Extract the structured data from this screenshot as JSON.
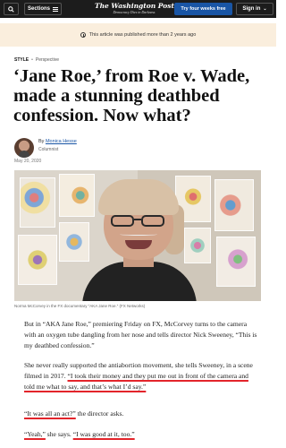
{
  "nav": {
    "sections_label": "Sections",
    "masthead": "The Washington Post",
    "tagline": "Democracy Dies in Darkness",
    "subscribe_label": "Try four weeks free",
    "signin_label": "Sign in",
    "signin_chevron": "⌄"
  },
  "banner": {
    "text": "This article was published more than 2 years ago"
  },
  "kicker": {
    "section": "STYLE",
    "separator": "•",
    "label": "Perspective"
  },
  "headline": "‘Jane Roe,’ from Roe v. Wade, made a stunning deathbed confession. Now what?",
  "byline": {
    "by": "By",
    "author": "Monica Hesse",
    "role": "Columnist",
    "date": "May 20, 2020"
  },
  "photo": {
    "caption": "Norma McCorvey in the FX documentary “AKA Jane Roe.” (FX Networks)"
  },
  "body": {
    "p1": "But in “AKA Jane Roe,” premiering Friday on FX, McCorvey turns to the camera with an oxygen tube dangling from her nose and tells director Nick Sweeney, “This is my deathbed confession.”",
    "p2_a": "She never really supported the antiabortion movement, she tells Sweeney, in a scene filmed in 2017. ",
    "p2_b": "“I took their money and they put me out in front of the camera and told me what to say, and that’s what I’d say.”",
    "p3_a": "“It was all an act?”",
    "p3_b": " the director asks.",
    "p4_a": "“Yeah,”",
    "p4_b": " she says. ",
    "p4_c": "“I was good at it, too.”"
  },
  "colors": {
    "nav_bg": "#1c1c1c",
    "subscribe_bg": "#1955a5",
    "banner_bg": "#faeedd",
    "underline": "#e3242b"
  },
  "icons": [
    "search-icon",
    "menu-icon",
    "chevron-down-icon",
    "clock-icon"
  ]
}
